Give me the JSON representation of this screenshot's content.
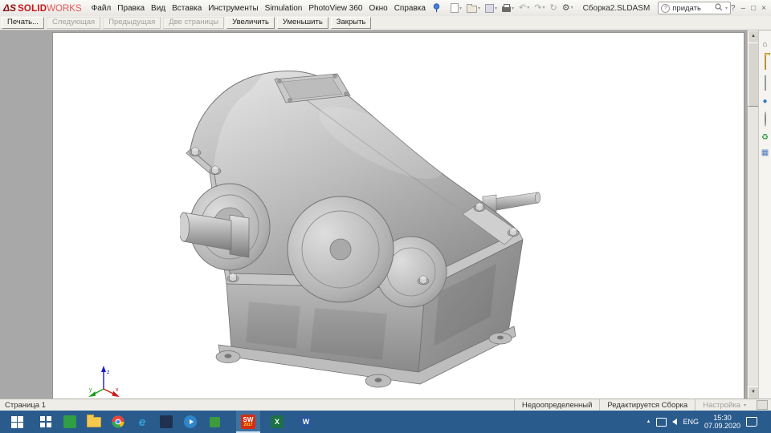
{
  "app": {
    "logo": {
      "ds": "ΔS",
      "solid": "SOLID",
      "works": "WORKS"
    },
    "document_name": "Сборка2.SLDASM",
    "search_text": "придать",
    "window_controls": {
      "help": "?",
      "minimize": "–",
      "maximize": "□",
      "close": "×"
    }
  },
  "menus": [
    "Файл",
    "Правка",
    "Вид",
    "Вставка",
    "Инструменты",
    "Simulation",
    "PhotoView 360",
    "Окно",
    "Справка"
  ],
  "toolbar_icon_names": [
    "new-document",
    "open",
    "save",
    "print",
    "undo",
    "redo",
    "rebuild",
    "options"
  ],
  "glyphs": {
    "dropdown": "▾",
    "undo": "↶",
    "redo": "↷",
    "rebuild": "↻",
    "options": "⚙",
    "help": "?",
    "scroll_up": "▲",
    "scroll_down": "▼",
    "tray_chevron": "▲",
    "home": "⌂",
    "sustainability": "♻",
    "properties": "▦",
    "forum": "●",
    "pin": "pushpin-shape",
    "folder": "folder-shape",
    "new_page": "page-shape",
    "floppy": "floppy-shape",
    "printer": "printer-shape",
    "magnifier": "magnifier-shape"
  },
  "preview_toolbar": {
    "print": "Печать...",
    "next": "Следующая",
    "prev": "Предыдущая",
    "two_pages": "Две страницы",
    "zoom_in": "Увеличить",
    "zoom_out": "Уменьшить",
    "close": "Закрыть"
  },
  "statusbar": {
    "page": "Страница 1",
    "state": "Недоопределенный",
    "editing": "Редактируется Сборка",
    "settings": "Настройка"
  },
  "taskbar": {
    "lang": "ENG",
    "time": "15:30",
    "date": "07.09.2020",
    "apps": [
      {
        "name": "app-grid",
        "color": "#ffffff"
      },
      {
        "name": "app-green",
        "color": "#2f9e44"
      },
      {
        "name": "explorer",
        "color": "#f5c94e"
      },
      {
        "name": "chrome",
        "color": "#ea4335"
      },
      {
        "name": "internet-explorer",
        "color": "#35a3dd",
        "label": "e"
      },
      {
        "name": "app-dark",
        "color": "#20304f"
      },
      {
        "name": "app-media",
        "color": "#2f86c9"
      },
      {
        "name": "app-green-2",
        "color": "#3d9b3d"
      },
      {
        "name": "solidworks-2017",
        "color": "#d42e12",
        "label": "SW",
        "sub": "2017",
        "active": true
      },
      {
        "name": "excel",
        "color": "#1e7145",
        "label": "X"
      },
      {
        "name": "word",
        "color": "#2b579a",
        "label": "W"
      }
    ]
  },
  "triad": {
    "x": "x",
    "y": "y",
    "z": "z"
  },
  "colors": {
    "taskbar": "#2a5b8d",
    "solidworks_red": "#c8151b",
    "viewport_gray": "#a8a8a8",
    "model_gray": "#b2b2b2",
    "word_blue": "#2b579a",
    "excel_green": "#1e7145",
    "ie_blue": "#35a3dd"
  }
}
